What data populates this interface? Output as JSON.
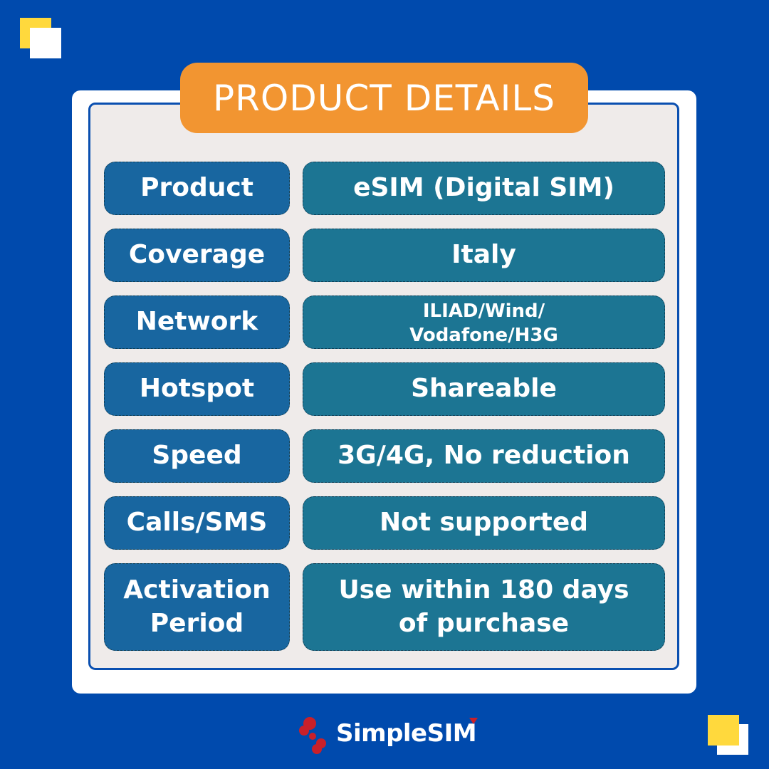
{
  "title": "PRODUCT DETAILS",
  "rows": [
    {
      "label": "Product",
      "value": "eSIM (Digital SIM)"
    },
    {
      "label": "Coverage",
      "value": "Italy"
    },
    {
      "label": "Network",
      "value_lines": [
        "ILIAD/Wind/",
        "Vodafone/H3G"
      ]
    },
    {
      "label": "Hotspot",
      "value": "Shareable"
    },
    {
      "label": "Speed",
      "value": "3G/4G, No reduction"
    },
    {
      "label": "Calls/SMS",
      "value": "Not supported"
    },
    {
      "label_lines": [
        "Activation",
        "Period"
      ],
      "value_lines": [
        "Use within 180 days",
        "of purchase"
      ]
    }
  ],
  "brand": {
    "name": "SimpleSIM",
    "logo_icon": "simplesim-logo-icon"
  },
  "colors": {
    "background": "#004aad",
    "title_pill": "#f29531",
    "label_cell": "#1866a0",
    "value_cell": "#1c7593",
    "panel": "#efebea",
    "accent_yellow": "#ffd93d",
    "logo_red": "#c8202a"
  }
}
